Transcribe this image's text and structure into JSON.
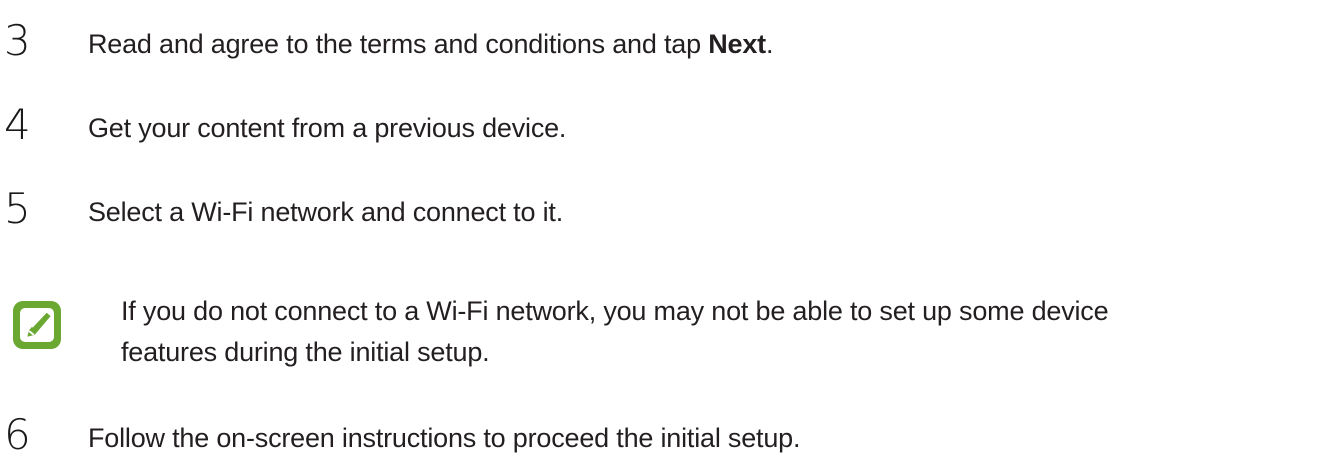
{
  "steps": [
    {
      "number": "3",
      "text_before": "Read and agree to the terms and conditions and tap ",
      "bold": "Next",
      "text_after": "."
    },
    {
      "number": "4",
      "text": "Get your content from a previous device."
    },
    {
      "number": "5",
      "text": "Select a Wi-Fi network and connect to it."
    },
    {
      "number": "6",
      "text": "Follow the on-screen instructions to proceed the initial setup."
    }
  ],
  "note": {
    "icon": "note-pencil-icon",
    "icon_color": "#6aa832",
    "line1": "If you do not connect to a Wi-Fi network, you may not be able to set up some device",
    "line2": "features during the initial setup."
  }
}
